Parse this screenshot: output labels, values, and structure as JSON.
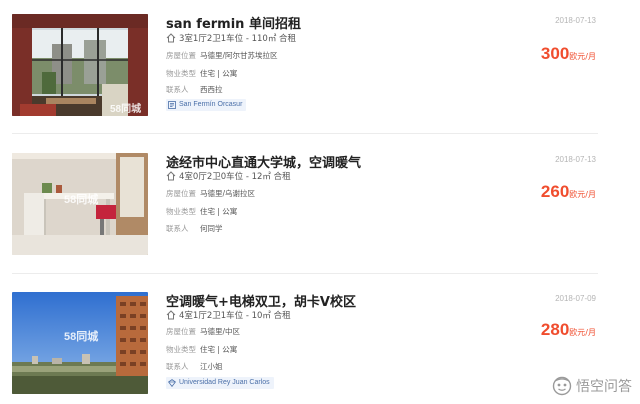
{
  "listings": [
    {
      "title": "san fermin 单间招租",
      "date": "2018-07-13",
      "specs": "3室1厅2卫1车位 - 110㎡ 合租",
      "location_label": "房屋位置",
      "location": "马德里/阿尔甘苏埃拉区",
      "type_label": "物业类型",
      "type": "住宅 | 公寓",
      "contact_label": "联系人",
      "contact": "西西拉",
      "price": "300",
      "price_unit": "欧元/月",
      "tag": "San Fermín Orcasur",
      "watermark": "58同城"
    },
    {
      "title": "途经市中心直通大学城，空调暖气",
      "date": "2018-07-13",
      "specs": "4室0厅2卫0车位 - 12㎡ 合租",
      "location_label": "房屋位置",
      "location": "马德里/乌谢拉区",
      "type_label": "物业类型",
      "type": "住宅 | 公寓",
      "contact_label": "联系人",
      "contact": "何同学",
      "price": "260",
      "price_unit": "欧元/月",
      "watermark": "58同城"
    },
    {
      "title": "空调暖气+电梯双卫，胡卡V校区",
      "date": "2018-07-09",
      "specs": "4室1厅2卫1车位 - 10㎡ 合租",
      "location_label": "房屋位置",
      "location": "马德里/中区",
      "type_label": "物业类型",
      "type": "住宅 | 公寓",
      "contact_label": "联系人",
      "contact": "江小姐",
      "price": "280",
      "price_unit": "欧元/月",
      "tag": "Universidad Rey Juan Carlos",
      "watermark": "58同城"
    }
  ],
  "brand": {
    "name": "悟空问答",
    "icon": "wukong-logo-icon"
  },
  "icons": {
    "specs": "house-icon",
    "tag": "map-pin-icon"
  },
  "colors": {
    "price": "#f04d2e",
    "tag_bg": "#eef3fb",
    "tag_text": "#4a6fa8"
  }
}
